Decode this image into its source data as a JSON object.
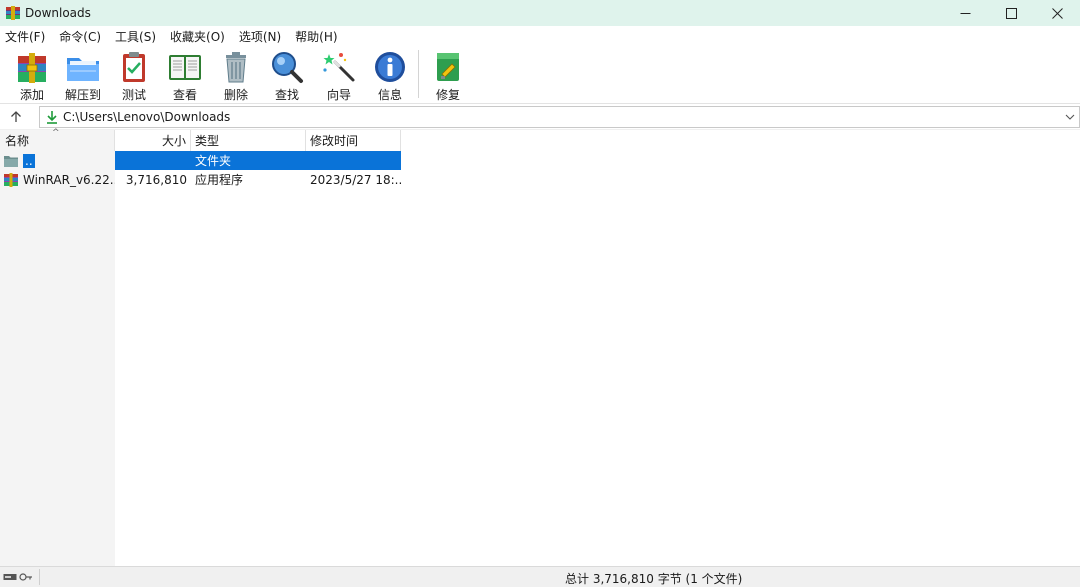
{
  "window": {
    "title": "Downloads"
  },
  "window_controls": {
    "minimize": "—",
    "maximize": "☐",
    "close": "✕"
  },
  "menu": [
    {
      "label": "文件(F)"
    },
    {
      "label": "命令(C)"
    },
    {
      "label": "工具(S)"
    },
    {
      "label": "收藏夹(O)"
    },
    {
      "label": "选项(N)"
    },
    {
      "label": "帮助(H)"
    }
  ],
  "toolbar": [
    {
      "label": "添加",
      "icon": "add-archive-icon"
    },
    {
      "label": "解压到",
      "icon": "extract-folder-icon"
    },
    {
      "label": "测试",
      "icon": "test-clipboard-icon"
    },
    {
      "label": "查看",
      "icon": "view-book-icon"
    },
    {
      "label": "删除",
      "icon": "trash-icon"
    },
    {
      "label": "查找",
      "icon": "magnifier-icon"
    },
    {
      "label": "向导",
      "icon": "wizard-wand-icon"
    },
    {
      "label": "信息",
      "icon": "info-icon"
    },
    {
      "label": "修复",
      "icon": "repair-icon"
    }
  ],
  "address": {
    "path": "C:\\Users\\Lenovo\\Downloads"
  },
  "columns": {
    "name": "名称",
    "size": "大小",
    "type": "类型",
    "modified": "修改时间"
  },
  "files": [
    {
      "name": "..",
      "size": "",
      "type": "文件夹",
      "modified": "",
      "selected": true
    },
    {
      "name": "WinRAR_v6.22...",
      "size": "3,716,810",
      "type": "应用程序",
      "modified": "2023/5/27 18:...",
      "selected": false
    }
  ],
  "status": {
    "summary": "总计 3,716,810 字节 (1 个文件)"
  },
  "colors": {
    "selection": "#0a73d8",
    "titlebar": "#dff3ec"
  }
}
